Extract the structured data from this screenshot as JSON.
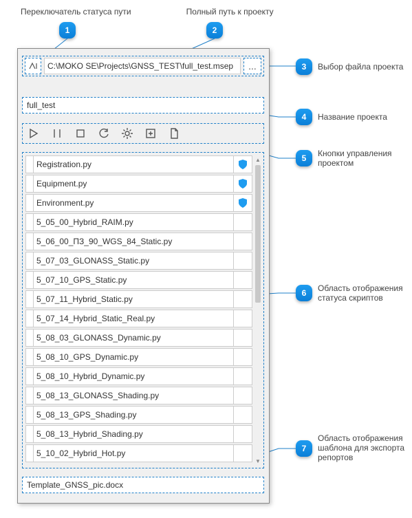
{
  "callouts": {
    "c1": {
      "num": "1",
      "text": "Переключатель статуса пути"
    },
    "c2": {
      "num": "2",
      "text": "Полный путь к проекту"
    },
    "c3": {
      "num": "3",
      "text": "Выбор файла проекта"
    },
    "c4": {
      "num": "4",
      "text": "Название проекта"
    },
    "c5": {
      "num": "5",
      "text": "Кнопки управления проектом"
    },
    "c6": {
      "num": "6",
      "text": "Область отображения статуса скриптов"
    },
    "c7": {
      "num": "7",
      "text": "Область отображения шаблона для экспорта репортов"
    }
  },
  "path": {
    "value": "C:\\MOKO SE\\Projects\\GNSS_TEST\\full_test.msep",
    "browse": "..."
  },
  "project_name": "full_test",
  "template": "Template_GNSS_pic.docx",
  "scripts": [
    {
      "name": "Registration.py",
      "shield": true
    },
    {
      "name": "Equipment.py",
      "shield": true
    },
    {
      "name": "Environment.py",
      "shield": true
    },
    {
      "name": "5_05_00_Hybrid_RAIM.py",
      "shield": false
    },
    {
      "name": "5_06_00_ПЗ_90_WGS_84_Static.py",
      "shield": false
    },
    {
      "name": "5_07_03_GLONASS_Static.py",
      "shield": false
    },
    {
      "name": "5_07_10_GPS_Static.py",
      "shield": false
    },
    {
      "name": "5_07_11_Hybrid_Static.py",
      "shield": false
    },
    {
      "name": "5_07_14_Hybrid_Static_Real.py",
      "shield": false
    },
    {
      "name": "5_08_03_GLONASS_Dynamic.py",
      "shield": false
    },
    {
      "name": "5_08_10_GPS_Dynamic.py",
      "shield": false
    },
    {
      "name": "5_08_10_Hybrid_Dynamic.py",
      "shield": false
    },
    {
      "name": "5_08_13_GLONASS_Shading.py",
      "shield": false
    },
    {
      "name": "5_08_13_GPS_Shading.py",
      "shield": false
    },
    {
      "name": "5_08_13_Hybrid_Shading.py",
      "shield": false
    },
    {
      "name": "5_10_02_Hybrid_Hot.py",
      "shield": false
    }
  ]
}
